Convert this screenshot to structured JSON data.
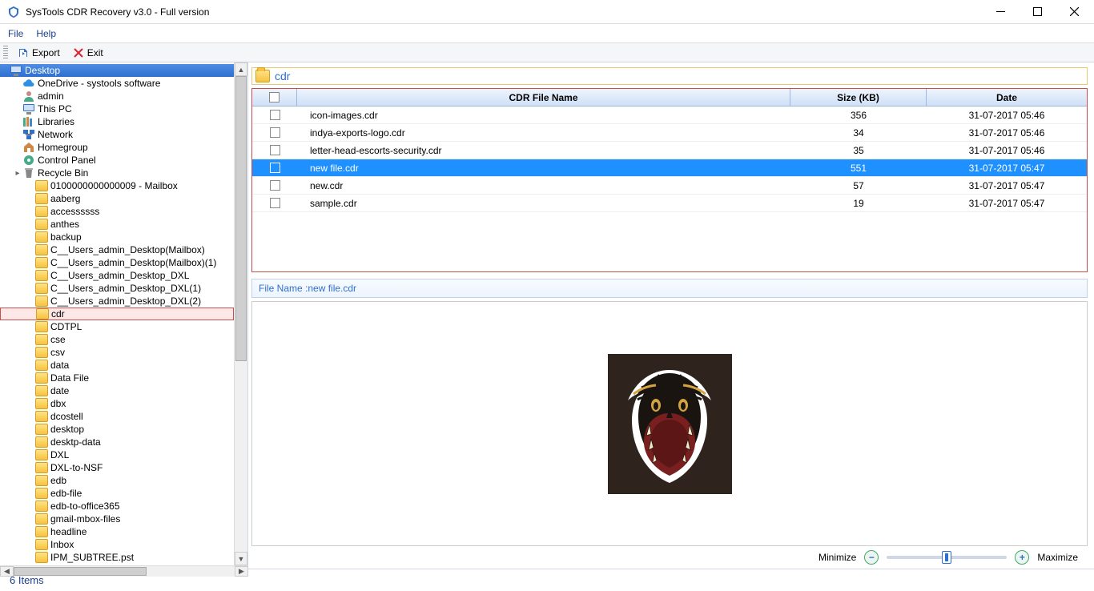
{
  "window": {
    "title": "SysTools CDR Recovery v3.0 - Full version"
  },
  "menu": {
    "file": "File",
    "help": "Help"
  },
  "toolbar": {
    "export": "Export",
    "exit": "Exit"
  },
  "tree": {
    "root": "Desktop",
    "top": [
      {
        "label": "OneDrive - systools software",
        "icon": "cloud"
      },
      {
        "label": "admin",
        "icon": "user"
      },
      {
        "label": "This PC",
        "icon": "pc"
      },
      {
        "label": "Libraries",
        "icon": "lib"
      },
      {
        "label": "Network",
        "icon": "net"
      },
      {
        "label": "Homegroup",
        "icon": "home"
      },
      {
        "label": "Control Panel",
        "icon": "cpl"
      },
      {
        "label": "Recycle Bin",
        "icon": "bin",
        "expandable": true
      }
    ],
    "folders": [
      "0100000000000009 - Mailbox",
      "aaberg",
      "accessssss",
      "anthes",
      "backup",
      "C__Users_admin_Desktop(Mailbox)",
      "C__Users_admin_Desktop(Mailbox)(1)",
      "C__Users_admin_Desktop_DXL",
      "C__Users_admin_Desktop_DXL(1)",
      "C__Users_admin_Desktop_DXL(2)"
    ],
    "selected": "cdr",
    "folders2": [
      "CDTPL",
      "cse",
      "csv",
      "data",
      "Data File",
      "date",
      "dbx",
      "dcostell",
      "desktop",
      "desktp-data",
      "DXL",
      "DXL-to-NSF",
      "edb",
      "edb-file",
      "edb-to-office365",
      "gmail-mbox-files",
      "headline",
      "Inbox",
      "IPM_SUBTREE.pst"
    ]
  },
  "crumb": "cdr",
  "grid": {
    "head": {
      "name": "CDR File Name",
      "size": "Size (KB)",
      "date": "Date"
    },
    "rows": [
      {
        "name": "icon-images.cdr",
        "size": "356",
        "date": "31-07-2017 05:46",
        "sel": false
      },
      {
        "name": "indya-exports-logo.cdr",
        "size": "34",
        "date": "31-07-2017 05:46",
        "sel": false
      },
      {
        "name": "letter-head-escorts-security.cdr",
        "size": "35",
        "date": "31-07-2017 05:46",
        "sel": false
      },
      {
        "name": "new file.cdr",
        "size": "551",
        "date": "31-07-2017 05:47",
        "sel": true
      },
      {
        "name": "new.cdr",
        "size": "57",
        "date": "31-07-2017 05:47",
        "sel": false
      },
      {
        "name": "sample.cdr",
        "size": "19",
        "date": "31-07-2017 05:47",
        "sel": false
      }
    ]
  },
  "filename_label": "File Name : ",
  "filename_value": "new file.cdr",
  "zoom": {
    "min": "Minimize",
    "max": "Maximize"
  },
  "status": "6 Items"
}
